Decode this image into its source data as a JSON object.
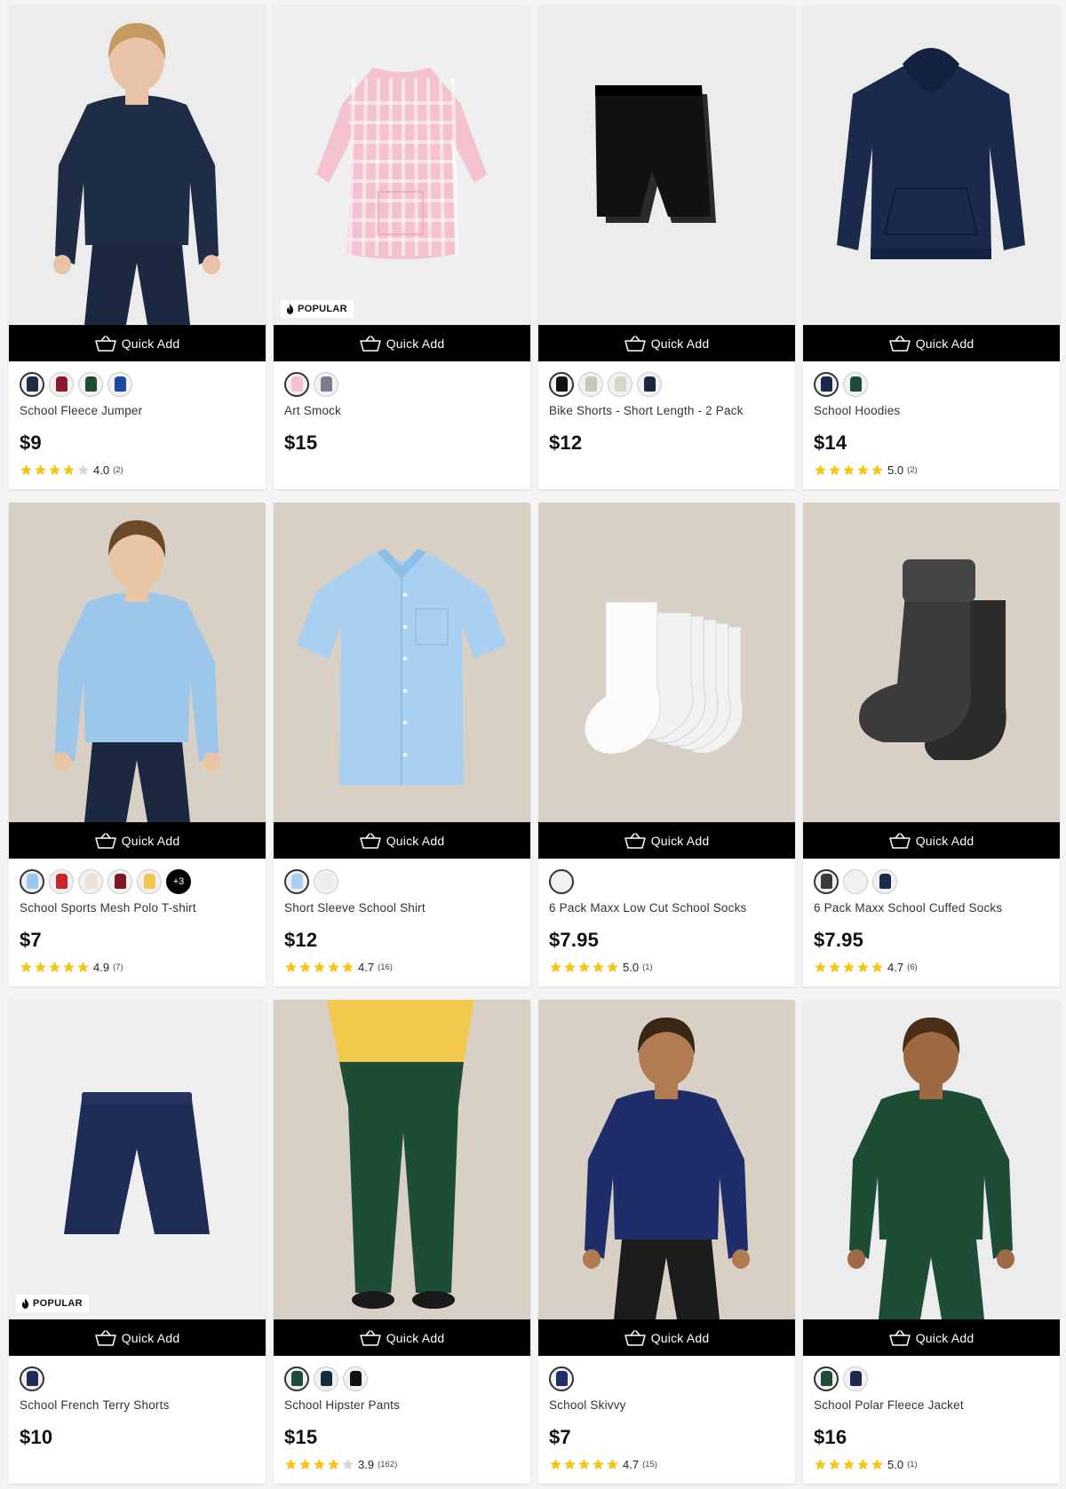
{
  "quick_add_label": "Quick Add",
  "popular_label": "POPULAR",
  "colors": {
    "accent_black": "#000000",
    "star_gold": "#f5c518",
    "star_empty": "#d6d6d6"
  },
  "products": [
    {
      "name": "School Fleece Jumper",
      "price": "$9",
      "rating": "4.0",
      "count": "(2)",
      "stars": 4,
      "badge": "",
      "image": {
        "bg": "#ececec",
        "shape": "model",
        "color": "#1f2c45",
        "pants": "#1c2740",
        "skin": "#e8c3a8",
        "hair": "#c49a60"
      },
      "swatches": [
        "#1f2c45",
        "#8a1a2d",
        "#1e4d35",
        "#1c4a9c"
      ]
    },
    {
      "name": "Art Smock",
      "price": "$15",
      "rating": "",
      "count": "",
      "stars": 0,
      "badge": "POPULAR",
      "image": {
        "bg": "#efefef",
        "shape": "smock",
        "color": "#f4c2cc"
      },
      "swatches": [
        "#f4c2cc",
        "#7a7e8a"
      ]
    },
    {
      "name": "Bike Shorts - Short Length - 2 Pack",
      "price": "$12",
      "rating": "",
      "count": "",
      "stars": 0,
      "badge": "",
      "image": {
        "bg": "#ececec",
        "shape": "bikeshorts",
        "color": "#111111"
      },
      "swatches": [
        "#111111",
        "#c8c4be",
        "#d8d4ce",
        "#1c2740"
      ]
    },
    {
      "name": "School Hoodies",
      "price": "$14",
      "rating": "5.0",
      "count": "(2)",
      "stars": 5,
      "badge": "",
      "image": {
        "bg": "#ececec",
        "shape": "hoodie",
        "color": "#1b2a4c"
      },
      "swatches": [
        "#1b2a4c",
        "#1e4d35"
      ]
    },
    {
      "name": "School Sports Mesh Polo T-shirt",
      "price": "$7",
      "rating": "4.9",
      "count": "(7)",
      "stars": 5,
      "badge": "",
      "image": {
        "bg": "#d8cfc5",
        "shape": "model",
        "color": "#9cc6ea",
        "pants": "#1c2740",
        "skin": "#eac5a4",
        "hair": "#6b4a2a"
      },
      "swatches": [
        "#9cc6ea",
        "#c9262c",
        "#e8e2d8",
        "#7b1a26",
        "#f2c94c"
      ],
      "more": "+3"
    },
    {
      "name": "Short Sleeve School Shirt",
      "price": "$12",
      "rating": "4.7",
      "count": "(16)",
      "stars": 5,
      "badge": "",
      "image": {
        "bg": "#d8cfc5",
        "shape": "shirt",
        "color": "#a9d0f0"
      },
      "swatches": [
        "#a9d0f0",
        "#f1ede6"
      ]
    },
    {
      "name": "6 Pack Maxx Low Cut School Socks",
      "price": "$7.95",
      "rating": "5.0",
      "count": "(1)",
      "stars": 5,
      "badge": "",
      "image": {
        "bg": "#d8cfc5",
        "shape": "socks",
        "color": "#fbfbfb"
      },
      "swatches": [
        "#f1f1f1"
      ]
    },
    {
      "name": "6 Pack Maxx School Cuffed Socks",
      "price": "$7.95",
      "rating": "4.7",
      "count": "(6)",
      "stars": 5,
      "badge": "",
      "image": {
        "bg": "#d8cfc5",
        "shape": "cuffsocks",
        "color": "#3b3b3b"
      },
      "swatches": [
        "#3b3b3b",
        "#f1f1f1",
        "#1b2a4c"
      ]
    },
    {
      "name": "School French Terry Shorts",
      "price": "$10",
      "rating": "",
      "count": "",
      "stars": 0,
      "badge": "POPULAR",
      "image": {
        "bg": "#efefef",
        "shape": "shorts",
        "color": "#1f2d55"
      },
      "swatches": [
        "#1f2d55"
      ]
    },
    {
      "name": "School Hipster Pants",
      "price": "$15",
      "rating": "3.9",
      "count": "(162)",
      "stars": 4,
      "badge": "",
      "image": {
        "bg": "#d8cfc5",
        "shape": "pants",
        "color": "#1e4d35",
        "top": "#f2c94c"
      },
      "swatches": [
        "#1e4d35",
        "#1c2740",
        "#111111"
      ]
    },
    {
      "name": "School Skivvy",
      "price": "$7",
      "rating": "4.7",
      "count": "(15)",
      "stars": 5,
      "badge": "",
      "image": {
        "bg": "#d8cfc5",
        "shape": "model",
        "color": "#1f2d6b",
        "pants": "#1c1c1c",
        "skin": "#b07a52",
        "hair": "#3a2615"
      },
      "swatches": [
        "#1f2d6b"
      ]
    },
    {
      "name": "School Polar Fleece Jacket",
      "price": "$16",
      "rating": "5.0",
      "count": "(1)",
      "stars": 5,
      "badge": "",
      "image": {
        "bg": "#ececec",
        "shape": "model",
        "color": "#1e4d35",
        "pants": "#1e4d35",
        "skin": "#9e6a44",
        "hair": "#4a2e18"
      },
      "swatches": [
        "#1e4d35",
        "#1b2a4c"
      ]
    }
  ]
}
